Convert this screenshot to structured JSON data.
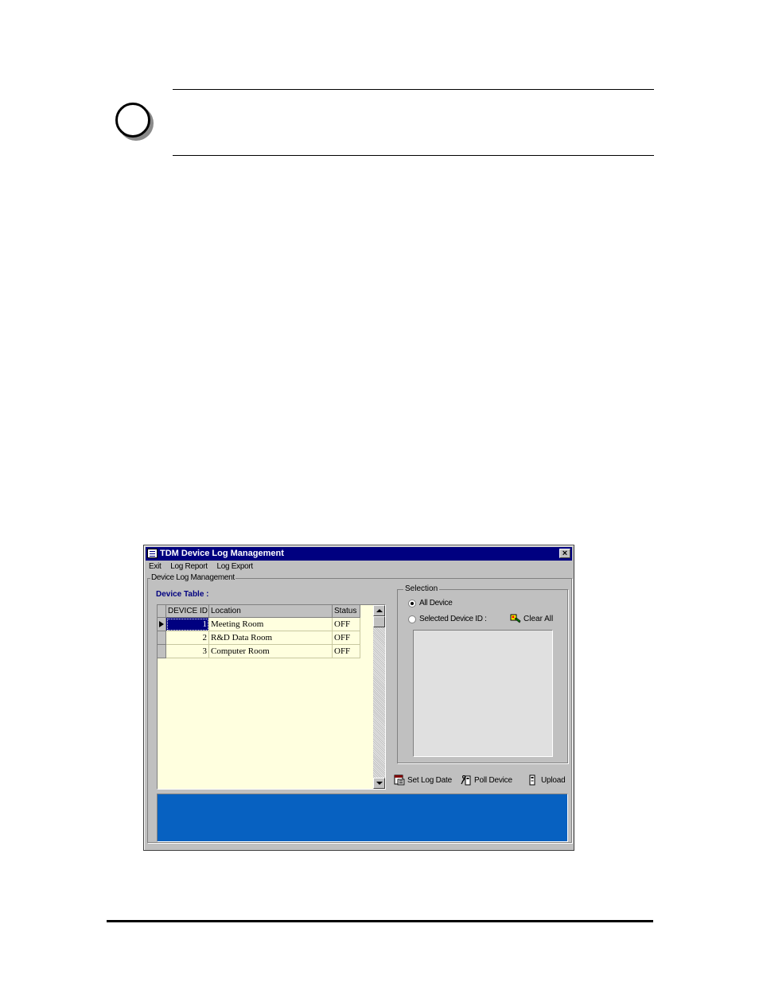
{
  "window": {
    "title": "TDM Device Log Management",
    "close_label": "×"
  },
  "menu": {
    "exit": "Exit",
    "log_report": "Log Report",
    "log_export": "Log Export"
  },
  "group_label": "Device Log Management",
  "device_table": {
    "label": "Device Table :",
    "columns": [
      "DEVICE ID",
      "Location",
      "Status"
    ],
    "rows": [
      {
        "id": "1",
        "location": "Meeting Room",
        "status": "OFF"
      },
      {
        "id": "2",
        "location": "R&D Data Room",
        "status": "OFF"
      },
      {
        "id": "3",
        "location": "Computer Room",
        "status": "OFF"
      }
    ]
  },
  "selection": {
    "label": "Selection",
    "all_device": "All Device",
    "selected_device_id": "Selected Device ID :",
    "clear_all": "Clear All",
    "selected_option": "All Device"
  },
  "toolbar": {
    "set_log_date": "Set Log Date",
    "poll_device": "Poll Device",
    "upload": "Upload"
  },
  "status_message": "",
  "colors": {
    "title_bar": "#000080",
    "status_bar": "#0761c1",
    "grid_background": "#ffffdf",
    "table_label": "#000080"
  }
}
